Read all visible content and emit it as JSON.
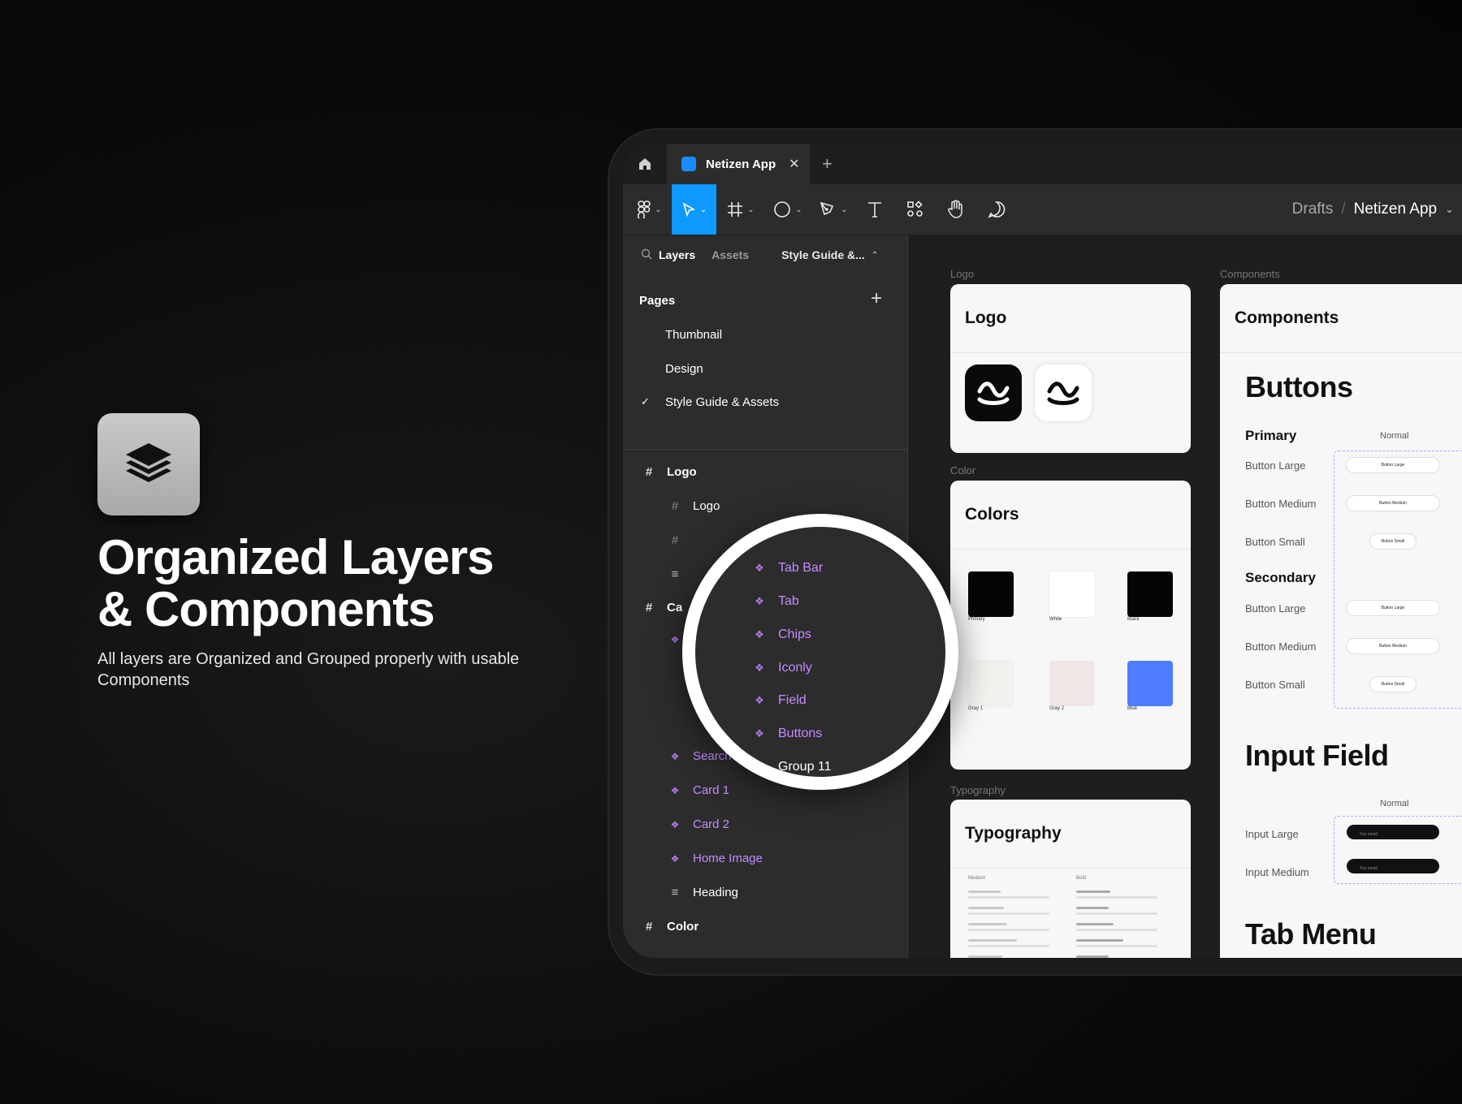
{
  "hero": {
    "title_line1": "Organized Layers",
    "title_line2": "& Components",
    "subtitle": "All layers are Organized and Grouped properly with usable Components",
    "badge_icon": "layers-icon"
  },
  "app": {
    "tab_name": "Netizen App",
    "breadcrumb": {
      "parent": "Drafts",
      "separator": "/",
      "current": "Netizen App"
    },
    "accent_color": "#0d99ff",
    "tools": [
      "figma-menu-icon",
      "move-icon",
      "frame-icon",
      "ellipse-icon",
      "pen-icon",
      "text-icon",
      "resources-icon",
      "hand-icon",
      "comment-icon"
    ]
  },
  "panel": {
    "tabs": {
      "layers": "Layers",
      "assets": "Assets",
      "page": "Style Guide &..."
    },
    "pages_heading": "Pages",
    "pages": [
      "Thumbnail",
      "Design",
      "Style Guide & Assets"
    ],
    "selected_page": "Style Guide & Assets",
    "layers": [
      {
        "type": "frame",
        "label": "Logo"
      },
      {
        "type": "frame-child",
        "label": "Logo"
      },
      {
        "type": "frame-child",
        "label": ""
      },
      {
        "type": "text",
        "label": ""
      },
      {
        "type": "frame",
        "label": "Ca"
      },
      {
        "type": "component",
        "label": "Search"
      },
      {
        "type": "component",
        "label": "Card 1"
      },
      {
        "type": "component",
        "label": "Card 2"
      },
      {
        "type": "component",
        "label": "Home Image"
      },
      {
        "type": "text",
        "label": "Heading"
      },
      {
        "type": "frame",
        "label": "Color"
      }
    ]
  },
  "magnifier": {
    "items": [
      {
        "type": "component",
        "label": "Tab Bar"
      },
      {
        "type": "component",
        "label": "Tab"
      },
      {
        "type": "component",
        "label": "Chips"
      },
      {
        "type": "component",
        "label": "Iconly"
      },
      {
        "type": "component",
        "label": "Field"
      },
      {
        "type": "component",
        "label": "Buttons"
      },
      {
        "type": "group",
        "label": "Group 11"
      }
    ]
  },
  "canvas": {
    "logo": {
      "frame_label": "Logo",
      "title": "Logo"
    },
    "colors": {
      "frame_label": "Color",
      "title": "Colors",
      "swatches": [
        {
          "name": "Primary",
          "color": "#050505"
        },
        {
          "name": "White",
          "color": "#ffffff"
        },
        {
          "name": "Black",
          "color": "#050505"
        },
        {
          "name": "Gray 1",
          "color": "#f1f1ee"
        },
        {
          "name": "Gray 2",
          "color": "#efe6e6"
        },
        {
          "name": "Blue",
          "color": "#4f7dff"
        }
      ]
    },
    "typography": {
      "frame_label": "Typography",
      "title": "Typography",
      "col1": "Medium",
      "col2": "Bold"
    },
    "components": {
      "frame_label": "Components",
      "title": "Components",
      "buttons_heading": "Buttons",
      "state_label": "Normal",
      "primary_label": "Primary",
      "secondary_label": "Secondary",
      "primary_rows": [
        "Button Large",
        "Button Medium",
        "Button Small"
      ],
      "secondary_rows": [
        "Button Large",
        "Button Medium",
        "Button Small"
      ],
      "input_heading": "Input Field",
      "input_rows": [
        "Input Large",
        "Input Medium"
      ],
      "input_placeholder": "You email",
      "tab_heading": "Tab Menu"
    }
  }
}
